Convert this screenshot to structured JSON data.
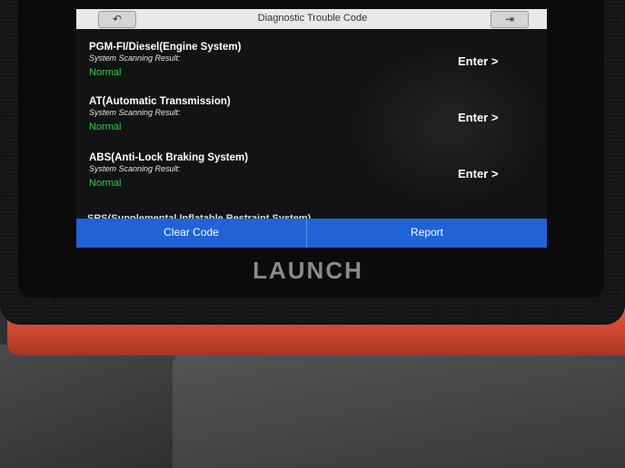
{
  "header": {
    "title": "Diagnostic Trouble Code",
    "back_icon": "back-arrow-icon",
    "exit_icon": "exit-icon"
  },
  "systems": [
    {
      "name": "PGM-FI/Diesel(Engine System)",
      "subtitle": "System Scanning Result:",
      "status": "Normal",
      "action": "Enter >"
    },
    {
      "name": "AT(Automatic Transmission)",
      "subtitle": "System Scanning Result:",
      "status": "Normal",
      "action": "Enter >"
    },
    {
      "name": "ABS(Anti-Lock Braking System)",
      "subtitle": "System Scanning Result:",
      "status": "Normal",
      "action": "Enter >"
    }
  ],
  "partial_item": "SRS(Supplemental Inflatable Restraint System)",
  "footer": {
    "clear_label": "Clear Code",
    "report_label": "Report"
  },
  "device": {
    "brand": "LAUNCH"
  },
  "colors": {
    "accent": "#1f63d6",
    "status_normal": "#29d13a",
    "case": "#d44e37"
  }
}
